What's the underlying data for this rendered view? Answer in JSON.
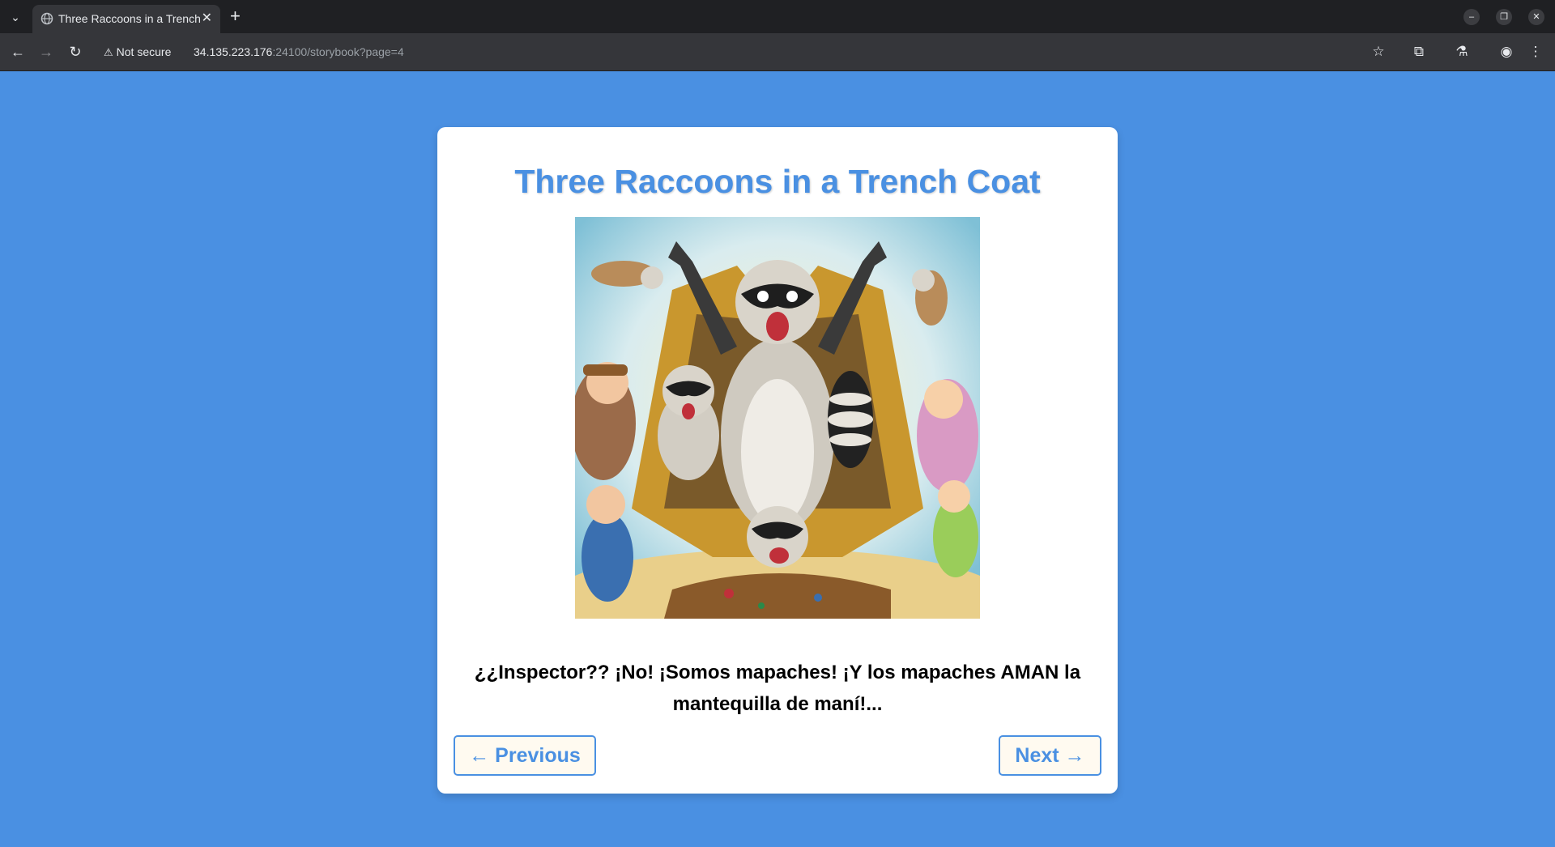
{
  "browser": {
    "tab_title": "Three Raccoons in a Trench Coat",
    "tab_close": "✕",
    "new_tab": "+",
    "security_label": "Not secure",
    "url_host": "34.135.223.176",
    "url_rest": ":24100/storybook?page=4",
    "icons": [
      "tab-list-icon",
      "globe-icon",
      "back-icon",
      "forward-icon",
      "reload-icon",
      "warning-icon",
      "star-icon",
      "extensions-icon",
      "labs-icon",
      "profile-icon",
      "menu-icon",
      "minimize-icon",
      "restore-icon",
      "close-icon"
    ]
  },
  "story": {
    "title": "Three Raccoons in a Trench Coat",
    "text": "¿¿Inspector?? ¡No! ¡Somos mapaches! ¡Y los mapaches AMAN la mantequilla de maní!...",
    "prev_label": "← Previous",
    "next_label": "Next →"
  },
  "colors": {
    "page_background": "#4a90e2",
    "title": "#4a90e2",
    "button_border": "#4a90e2",
    "button_background": "#fffaf0"
  }
}
